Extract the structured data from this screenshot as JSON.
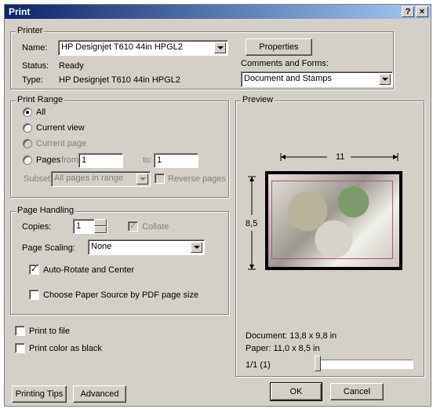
{
  "window": {
    "title": "Print",
    "help_btn": "?",
    "close_btn": "×"
  },
  "printer": {
    "legend": "Printer",
    "name_label": "Name:",
    "name_value": "HP Designjet T610 44in HPGL2",
    "status_label": "Status:",
    "status_value": "Ready",
    "type_label": "Type:",
    "type_value": "HP Designjet T610 44in HPGL2",
    "properties_label": "Properties",
    "comments_label": "Comments and Forms:",
    "comments_value": "Document and Stamps"
  },
  "print_range": {
    "legend": "Print Range",
    "all": "All",
    "current_view": "Current view",
    "current_page": "Current page",
    "pages": "Pages",
    "from_label": "from:",
    "from_value": "1",
    "to_label": "to:",
    "to_value": "1",
    "subset_label": "Subset:",
    "subset_value": "All pages in range",
    "reverse_pages": "Reverse pages"
  },
  "page_handling": {
    "legend": "Page Handling",
    "copies_label": "Copies:",
    "copies_value": "1",
    "collate": "Collate",
    "scaling_label": "Page Scaling:",
    "scaling_value": "None",
    "auto_rotate": "Auto-Rotate and Center",
    "choose_source": "Choose Paper Source by PDF page size"
  },
  "preview": {
    "legend": "Preview",
    "width_dim": "11",
    "height_dim": "8,5",
    "document_size": "Document: 13,8 x 9,8 in",
    "paper_size": "Paper: 11,0 x 8,5 in",
    "page_indicator": "1/1 (1)"
  },
  "options": {
    "print_to_file": "Print to file",
    "print_color_black": "Print color as black"
  },
  "buttons": {
    "printing_tips": "Printing Tips",
    "advanced": "Advanced",
    "ok": "OK",
    "cancel": "Cancel"
  }
}
